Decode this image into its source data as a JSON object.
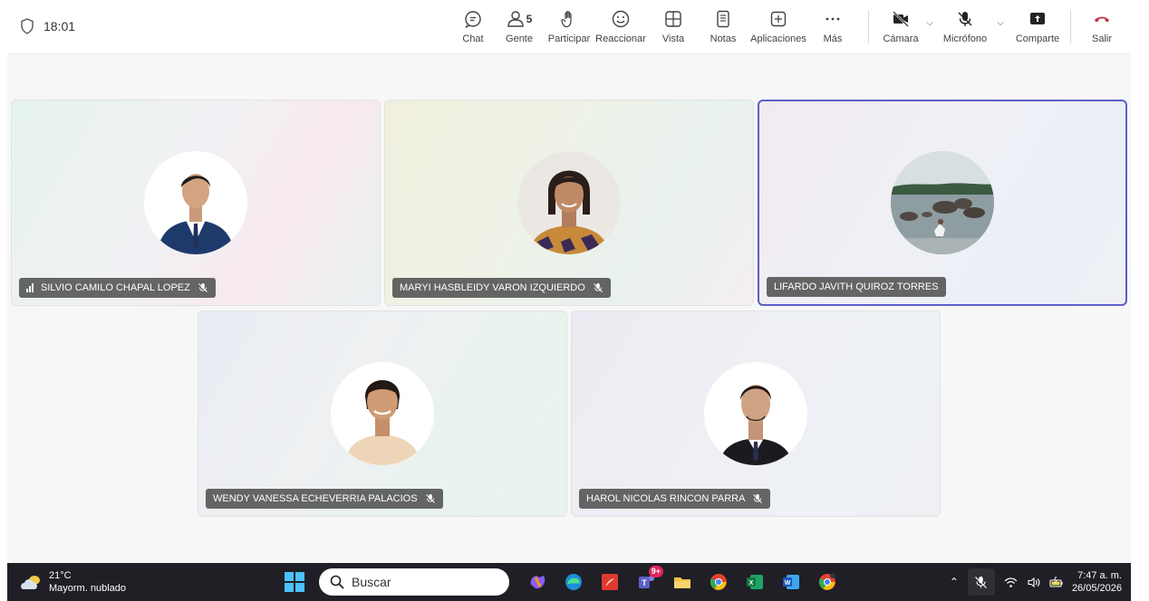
{
  "meeting": {
    "timer": "18:01"
  },
  "toolbar": {
    "chat": "Chat",
    "people": "Gente",
    "people_count": "5",
    "raise": "Participar",
    "react": "Reaccionar",
    "view": "Vista",
    "notes": "Notas",
    "apps": "Aplicaciones",
    "more": "Más",
    "camera": "Cámara",
    "mic": "Micrófono",
    "share": "Comparte",
    "leave": "Salir"
  },
  "participants": [
    {
      "name": "SILVIO CAMILO CHAPAL LOPEZ",
      "muted": true,
      "active": false
    },
    {
      "name": "MARYI HASBLEIDY VARON IZQUIERDO",
      "muted": true,
      "active": false
    },
    {
      "name": "LIFARDO JAVITH QUIROZ TORRES",
      "muted": false,
      "active": true
    },
    {
      "name": "WENDY VANESSA ECHEVERRIA PALACIOS",
      "muted": true,
      "active": false
    },
    {
      "name": "HAROL NICOLAS RINCON PARRA",
      "muted": true,
      "active": false
    }
  ],
  "taskbar": {
    "weather_temp": "21°C",
    "weather_desc": "Mayorm. nublado",
    "search_placeholder": "Buscar",
    "teams_badge": "9+",
    "time": "7:47 a. m.",
    "date": "26/05/2026"
  },
  "colors": {
    "accent": "#5b5fc7",
    "leave": "#c4314b",
    "taskbar": "#1f1f25"
  }
}
